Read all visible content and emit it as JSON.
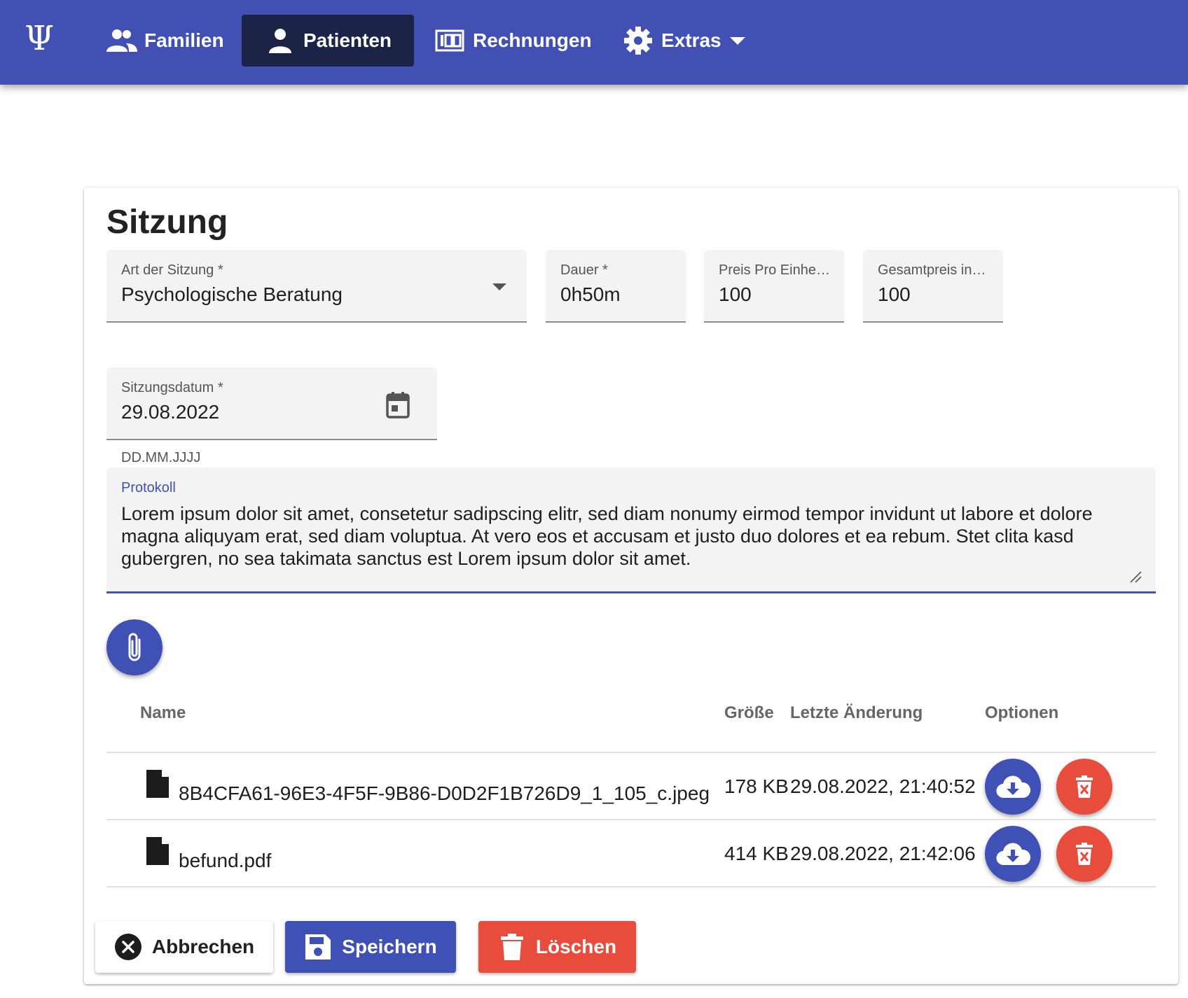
{
  "app": {
    "logo_glyph": "Ψ"
  },
  "nav": {
    "items": [
      {
        "label": "Familien",
        "icon": "people-icon"
      },
      {
        "label": "Patienten",
        "icon": "person-icon",
        "active": true
      },
      {
        "label": "Rechnungen",
        "icon": "money-icon"
      },
      {
        "label": "Extras",
        "icon": "gear-icon",
        "dropdown": true
      }
    ]
  },
  "page": {
    "title": "Sitzung"
  },
  "form": {
    "session_type": {
      "label": "Art der Sitzung *",
      "value": "Psychologische Beratung"
    },
    "duration": {
      "label": "Dauer *",
      "value": "0h50m"
    },
    "unit_price": {
      "label": "Preis Pro Einhe…",
      "value": "100"
    },
    "total_price": {
      "label": "Gesamtpreis in…",
      "value": "100"
    },
    "session_date": {
      "label": "Sitzungsdatum *",
      "value": "29.08.2022",
      "helper": "DD.MM.JJJJ"
    },
    "protocol": {
      "label": "Protokoll",
      "value": "Lorem ipsum dolor sit amet, consetetur sadipscing elitr, sed diam nonumy eirmod tempor invidunt ut labore et dolore magna aliquyam erat, sed diam voluptua. At vero eos et accusam et justo duo dolores et ea rebum. Stet clita kasd gubergren, no sea takimata sanctus est Lorem ipsum dolor sit amet."
    }
  },
  "files": {
    "headers": {
      "name": "Name",
      "size": "Größe",
      "modified": "Letzte Änderung",
      "options": "Optionen"
    },
    "rows": [
      {
        "name": "8B4CFA61-96E3-4F5F-9B86-D0D2F1B726D9_1_105_c.jpeg",
        "size": "178 KB",
        "modified": "29.08.2022, 21:40:52"
      },
      {
        "name": "befund.pdf",
        "size": "414 KB",
        "modified": "29.08.2022, 21:42:06"
      }
    ]
  },
  "actions": {
    "cancel": "Abbrechen",
    "save": "Speichern",
    "delete": "Löschen"
  },
  "colors": {
    "primary": "#3f51b5",
    "nav": "#4150b2",
    "nav_active": "#1b2347",
    "danger": "#e74c3c"
  }
}
